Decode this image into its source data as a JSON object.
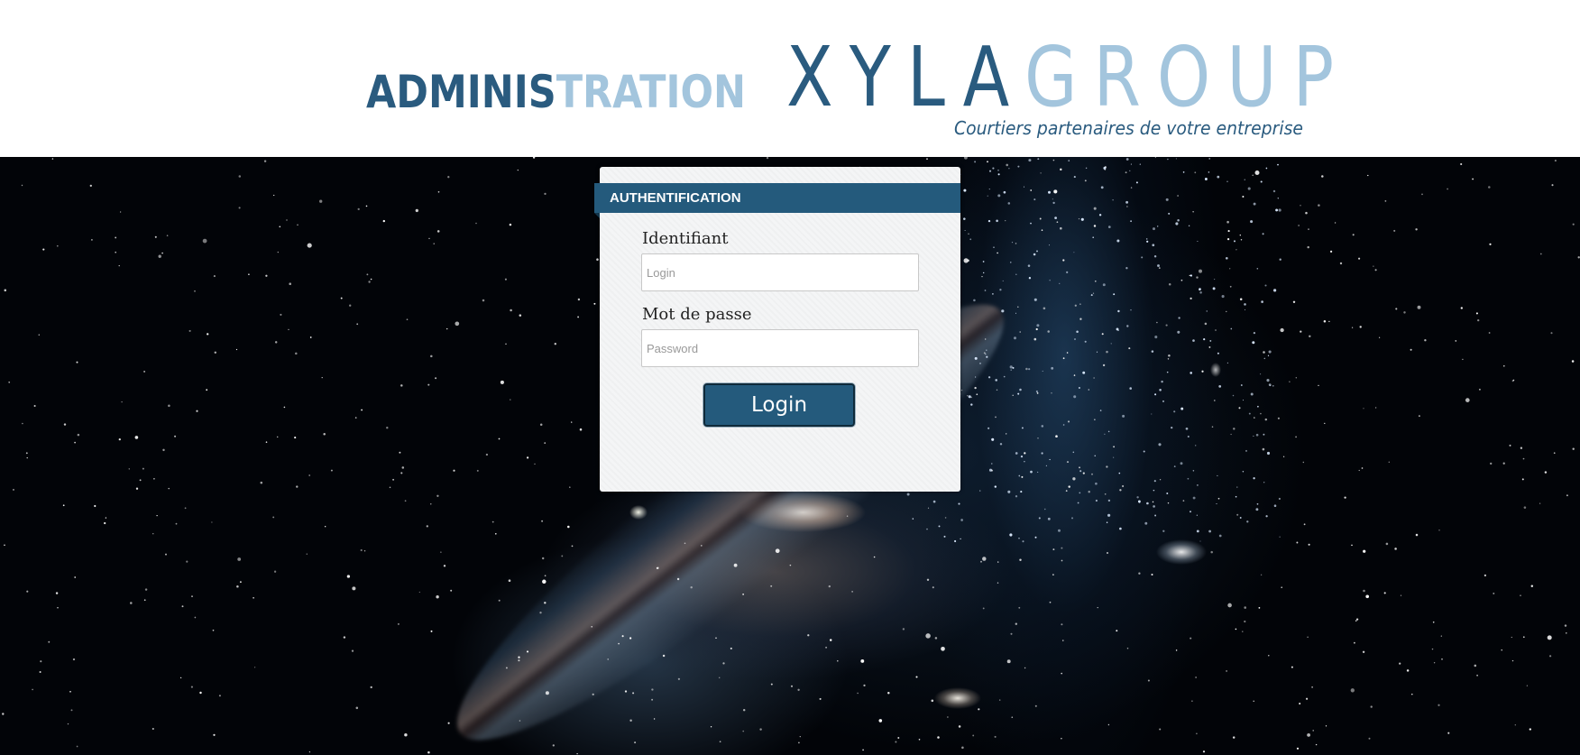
{
  "header": {
    "admin_title_dark": "ADMINIS",
    "admin_title_light": "TRATION",
    "brand_dark": "XYLA",
    "brand_light": "GROUP",
    "tagline": "Courtiers partenaires de votre entreprise"
  },
  "login_card": {
    "title": "AUTHENTIFICATION",
    "username_label": "Identifiant",
    "username_placeholder": "Login",
    "password_label": "Mot de passe",
    "password_placeholder": "Password",
    "submit_label": "Login"
  },
  "colors": {
    "brand_dark": "#2a5b7f",
    "brand_light": "#a3c5dd",
    "card_header": "#245a7c",
    "button": "#245a7c"
  }
}
